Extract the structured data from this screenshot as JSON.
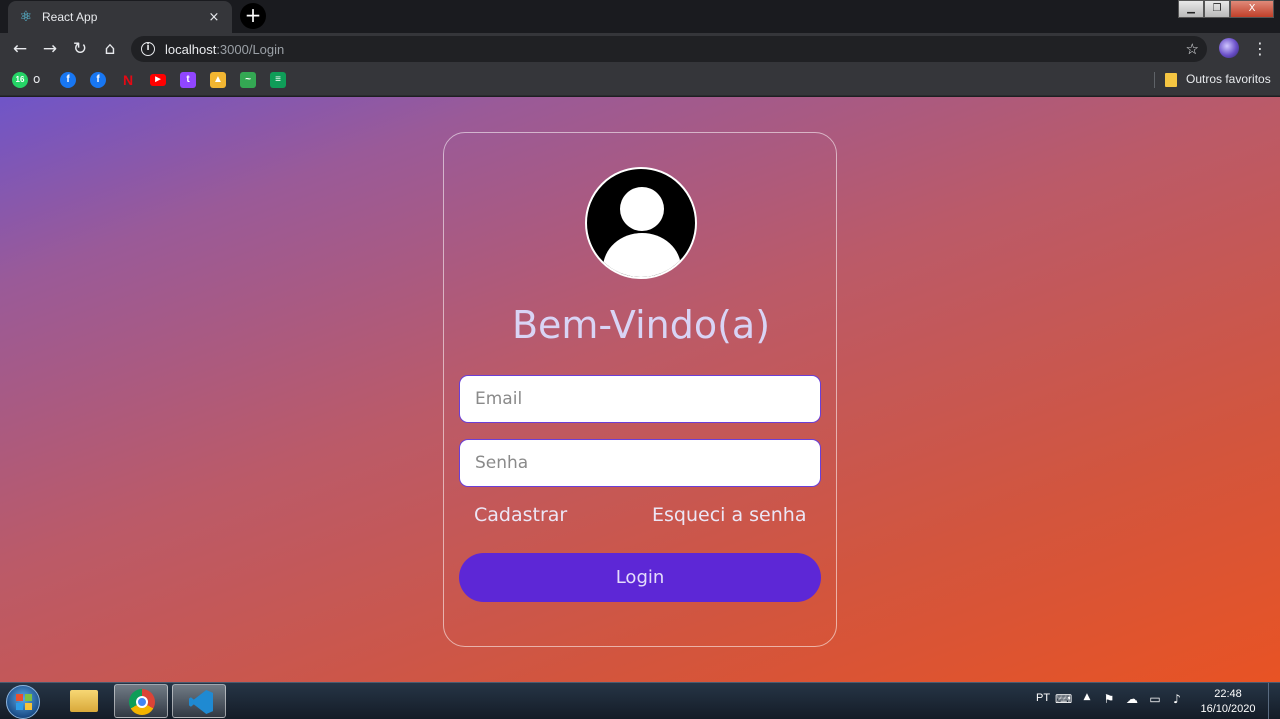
{
  "browser": {
    "tab_title": "React App",
    "tab_close": "×",
    "new_tab": "+",
    "url_host": "localhost",
    "url_rest": ":3000/Login",
    "back": "←",
    "forward": "→",
    "reload": "↻",
    "home": "⌂",
    "star": "☆",
    "menu": "⋮",
    "window_controls": {
      "minimize": "▁",
      "maximize": "❐",
      "close": "X"
    }
  },
  "bookmarks": {
    "whatsapp_badge": "16",
    "first_label": "o",
    "items": [
      {
        "icon": "whatsapp-icon",
        "color": "#25d366"
      },
      {
        "icon": "facebook-icon",
        "color": "#1877f2"
      },
      {
        "icon": "facebook-icon",
        "color": "#1877f2"
      },
      {
        "icon": "netflix-icon",
        "color": "#e50914"
      },
      {
        "icon": "youtube-icon",
        "color": "#ff0000"
      },
      {
        "icon": "twitch-icon",
        "color": "#9146ff"
      },
      {
        "icon": "image-icon",
        "color": "#f2b632"
      },
      {
        "icon": "chart-icon",
        "color": "#34a853"
      },
      {
        "icon": "sheets-icon",
        "color": "#0f9d58"
      }
    ],
    "other_folder": "Outros favoritos"
  },
  "login": {
    "welcome": "Bem-Vindo(a)",
    "email_placeholder": "Email",
    "password_placeholder": "Senha",
    "register_link": "Cadastrar",
    "forgot_link": "Esqueci a senha",
    "login_button": "Login",
    "accent_color": "#5d27d6"
  },
  "taskbar": {
    "language": "PT",
    "time": "22:48",
    "date": "16/10/2020"
  }
}
